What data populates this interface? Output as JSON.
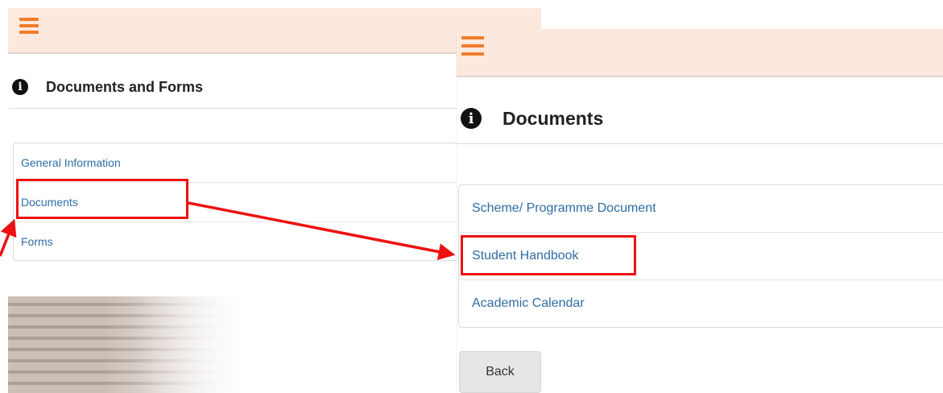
{
  "left_screen": {
    "heading": "Documents and Forms",
    "links": [
      "General Information",
      "Documents",
      "Forms"
    ]
  },
  "right_screen": {
    "heading": "Documents",
    "links": [
      "Scheme/ Programme Document",
      "Student Handbook",
      "Academic Calendar"
    ],
    "back_label": "Back"
  },
  "colors": {
    "topbar": "#fde8de",
    "hamburger": "#f07c29",
    "link": "#2e6da4",
    "highlight": "#ee1111"
  },
  "icons": {
    "menu": "hamburger-icon",
    "info": "info-icon"
  }
}
